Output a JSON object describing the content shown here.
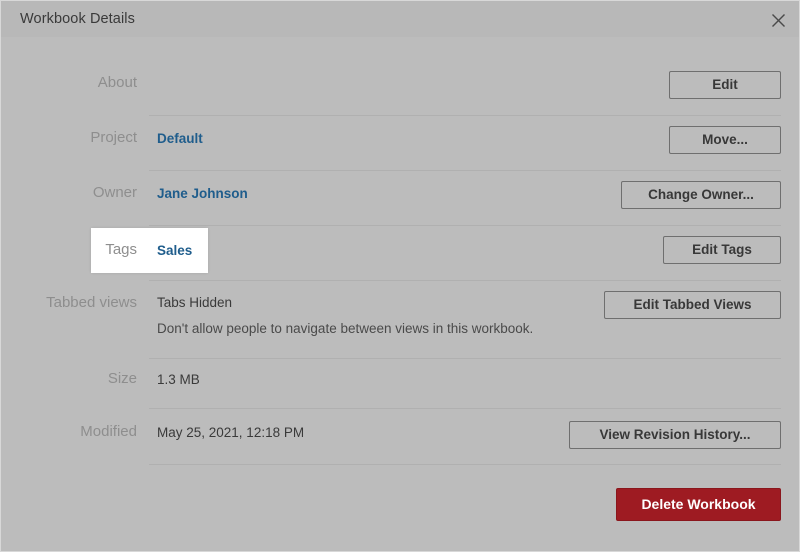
{
  "window": {
    "title": "Workbook Details",
    "close_icon": "close-icon"
  },
  "rows": [
    {
      "label": "About",
      "value": "",
      "button": "Edit"
    },
    {
      "label": "Project",
      "value": "Default",
      "button": "Move..."
    },
    {
      "label": "Owner",
      "value": "Jane Johnson",
      "button": "Change Owner..."
    },
    {
      "label": "Tags",
      "value": "Sales",
      "button": "Edit Tags"
    },
    {
      "label": "Tabbed views",
      "value": "Tabs Hidden",
      "description": "Don't allow people to navigate between views in this workbook.",
      "button": "Edit Tabbed Views"
    },
    {
      "label": "Size",
      "value": "1.3 MB",
      "button": ""
    },
    {
      "label": "Modified",
      "value": "May 25, 2021, 12:18 PM",
      "button": "View Revision History..."
    }
  ],
  "footer": {
    "delete_label": "Delete Workbook"
  },
  "highlight": {
    "label": "Tags",
    "value": "Sales"
  },
  "colors": {
    "dialog_background": "#bcbcbc",
    "titlebar_background": "#b8b8b8",
    "link": "#1f5d8c",
    "label_text": "#8e8e8e",
    "value_text": "#3a3a3a",
    "button_border": "#6f6f6f",
    "danger_background": "#9e1b22",
    "divider": "#b0b0b0",
    "highlight_background": "#ffffff"
  }
}
